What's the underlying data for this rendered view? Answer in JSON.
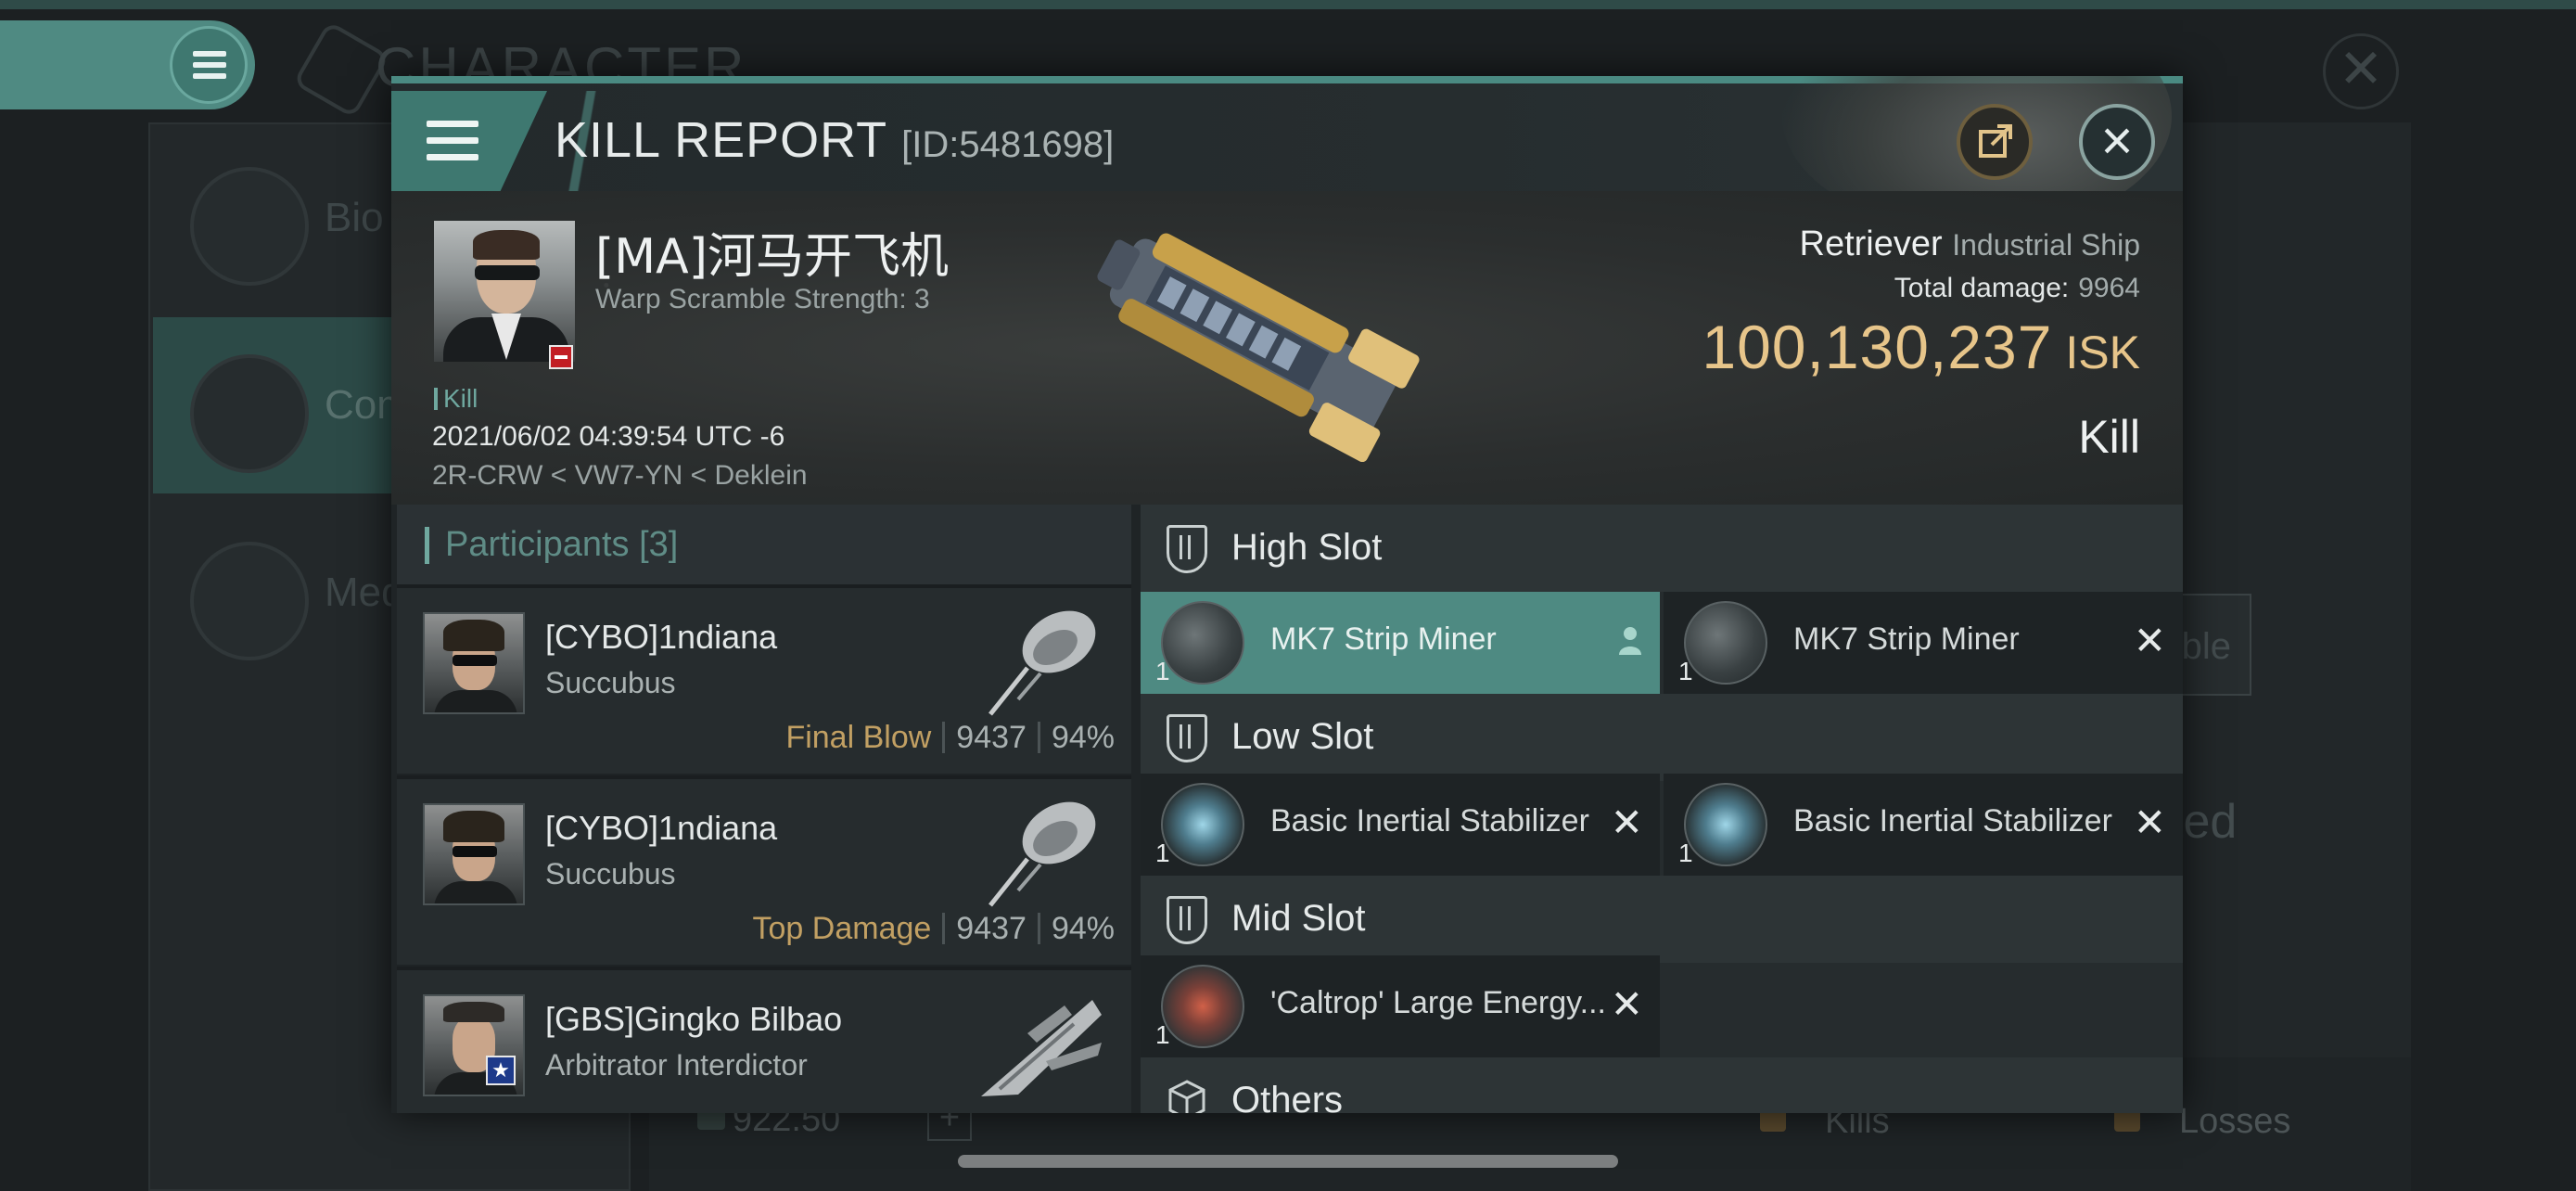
{
  "background": {
    "title": "CHARACTER",
    "sidebar_items": [
      {
        "label": "Bio"
      },
      {
        "label": "Com"
      },
      {
        "label": "Med"
      }
    ],
    "right_button_fragment": "ble",
    "right_text_fragment": "ted",
    "stat_value": "922.50",
    "kills_label": "Kills",
    "losses_label": "Losses"
  },
  "kill_report": {
    "title": "KILL REPORT",
    "id_label": "[ID:5481698]",
    "victim": {
      "name": "[MA]河马开飞机",
      "warp_scramble": "Warp Scramble Strength: 3",
      "kill_tag": "Kill",
      "timestamp": "2021/06/02 04:39:54 UTC -6",
      "location": "2R-CRW < VW7-YN < Deklein"
    },
    "ship": {
      "name": "Retriever",
      "class": "Industrial Ship",
      "damage_label": "Total damage:",
      "damage_value": "9964",
      "isk_value": "100,130,237",
      "isk_unit": "ISK",
      "result": "Kill"
    },
    "participants": {
      "title": "Participants",
      "count": "[3]",
      "rows": [
        {
          "name": "[CYBO]1ndiana",
          "ship": "Succubus",
          "tag": "Final Blow",
          "damage": "9437",
          "percent": "94%"
        },
        {
          "name": "[CYBO]1ndiana",
          "ship": "Succubus",
          "tag": "Top Damage",
          "damage": "9437",
          "percent": "94%"
        },
        {
          "name": "[GBS]Gingko Bilbao",
          "ship": "Arbitrator Interdictor"
        }
      ]
    },
    "fitting": {
      "high_slot": {
        "label": "High Slot",
        "modules": [
          {
            "name": "MK7 Strip Miner",
            "qty": "1"
          },
          {
            "name": "MK7 Strip Miner",
            "qty": "1"
          }
        ]
      },
      "low_slot": {
        "label": "Low Slot",
        "modules": [
          {
            "name": "Basic Inertial Stabilizer",
            "qty": "1"
          },
          {
            "name": "Basic Inertial Stabilizer",
            "qty": "1"
          }
        ]
      },
      "mid_slot": {
        "label": "Mid Slot",
        "modules": [
          {
            "name": "'Caltrop' Large Energy...",
            "qty": "1"
          }
        ]
      },
      "others": {
        "label": "Others"
      }
    }
  },
  "colors": {
    "accent": "#4e8a82",
    "isk": "#e7c58a",
    "tag_gold": "#c2a063",
    "victim_badge": "#c21e24"
  },
  "icons": [
    "menu-icon",
    "share-icon",
    "close-icon",
    "slot-icon",
    "cube-icon",
    "remove-icon",
    "user-icon"
  ]
}
